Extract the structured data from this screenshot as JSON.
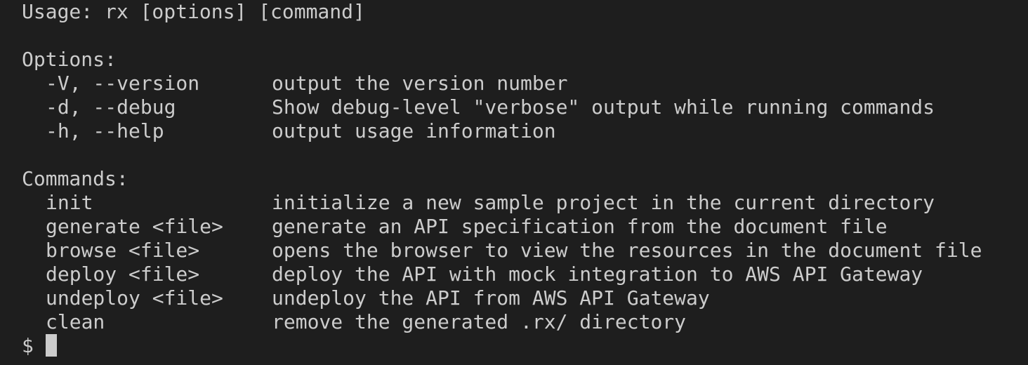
{
  "usage": "Usage: rx [options] [command]",
  "options_header": "Options:",
  "options": [
    {
      "flag": "-V, --version",
      "desc": "output the version number"
    },
    {
      "flag": "-d, --debug",
      "desc": "Show debug-level \"verbose\" output while running commands"
    },
    {
      "flag": "-h, --help",
      "desc": "output usage information"
    }
  ],
  "commands_header": "Commands:",
  "commands": [
    {
      "name": "init",
      "desc": "initialize a new sample project in the current directory"
    },
    {
      "name": "generate <file>",
      "desc": "generate an API specification from the document file"
    },
    {
      "name": "browse <file>",
      "desc": "opens the browser to view the resources in the document file"
    },
    {
      "name": "deploy <file>",
      "desc": "deploy the API with mock integration to AWS API Gateway"
    },
    {
      "name": "undeploy <file>",
      "desc": "undeploy the API from AWS API Gateway"
    },
    {
      "name": "clean",
      "desc": "remove the generated .rx/ directory"
    }
  ],
  "prompt": "$"
}
